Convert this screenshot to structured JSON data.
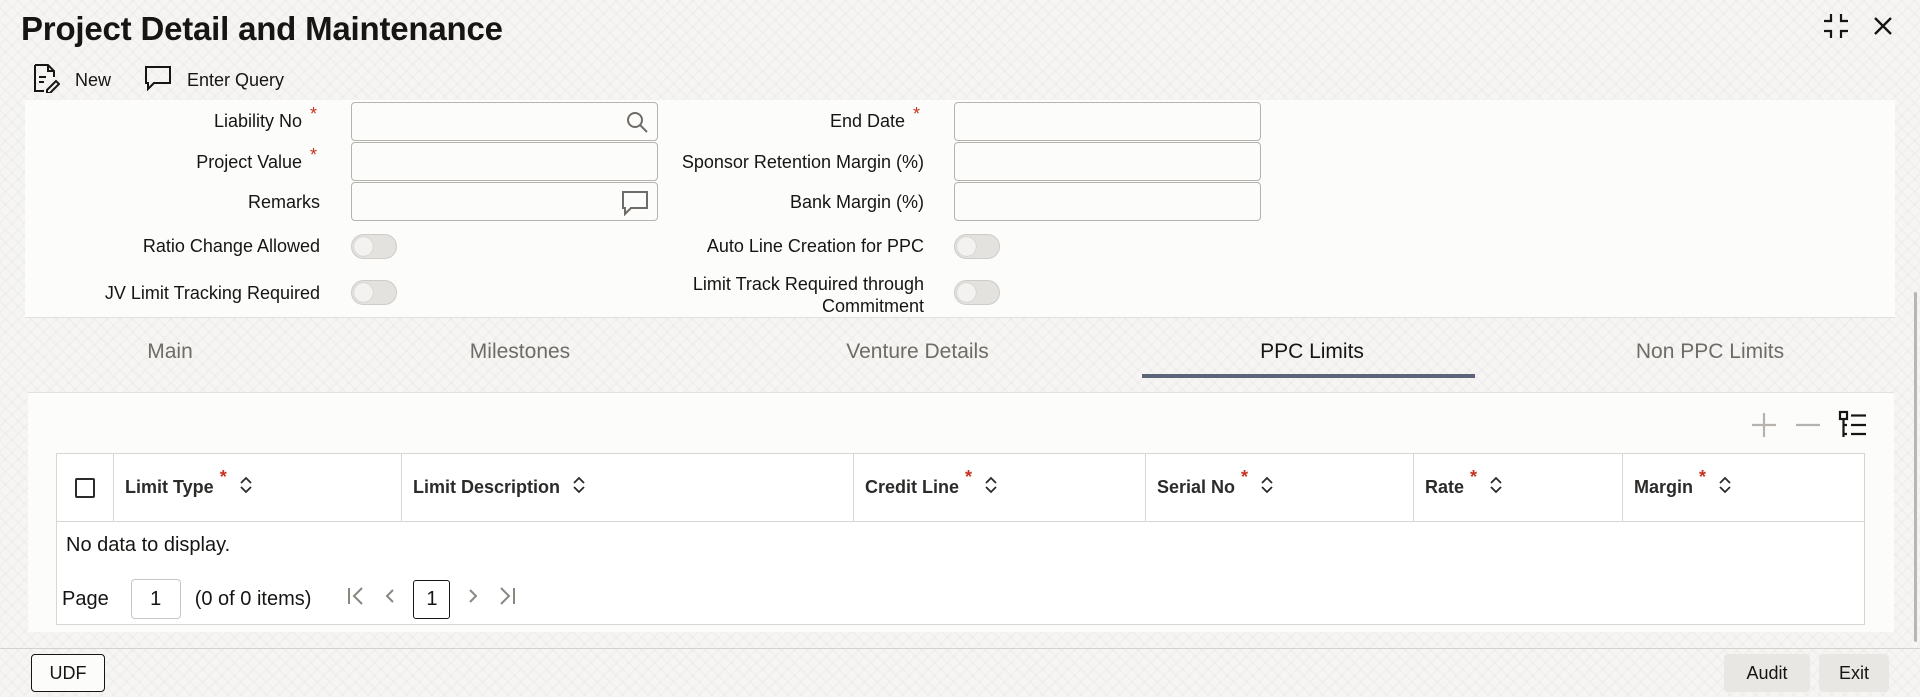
{
  "window": {
    "title": "Project Detail and Maintenance"
  },
  "toolbar": {
    "new_label": "New",
    "enter_query_label": "Enter Query"
  },
  "form": {
    "liability_no_label": "Liability No",
    "project_value_label": "Project Value",
    "remarks_label": "Remarks",
    "ratio_change_label": "Ratio Change Allowed",
    "jv_limit_label": "JV Limit Tracking Required",
    "end_date_label": "End Date",
    "sponsor_margin_label": "Sponsor Retention Margin (%)",
    "bank_margin_label": "Bank Margin (%)",
    "auto_line_label": "Auto Line Creation for PPC",
    "limit_track_label_1": "Limit Track Required through",
    "limit_track_label_2": "Commitment",
    "required_mark": "*",
    "liability_no_value": "",
    "project_value_value": "",
    "remarks_value": "",
    "end_date_value": "",
    "sponsor_margin_value": "",
    "bank_margin_value": ""
  },
  "tabs": {
    "main": "Main",
    "milestones": "Milestones",
    "venture_details": "Venture Details",
    "ppc_limits": "PPC Limits",
    "non_ppc_limits": "Non PPC Limits",
    "active": "PPC Limits"
  },
  "grid": {
    "columns": {
      "limit_type": "Limit Type",
      "limit_description": "Limit Description",
      "credit_line": "Credit Line",
      "serial_no": "Serial No",
      "rate": "Rate",
      "margin": "Margin"
    },
    "empty_message": "No data to display.",
    "rows": []
  },
  "pagination": {
    "page_label": "Page",
    "page_input_value": "1",
    "items_summary": "(0 of 0 items)",
    "current_page": "1"
  },
  "footer": {
    "udf_label": "UDF",
    "audit_label": "Audit",
    "exit_label": "Exit"
  },
  "colors": {
    "required": "#c7321f",
    "active_tab_underline": "#5b6479",
    "text": "#161513",
    "muted_text": "#6f6b66"
  },
  "icons": [
    "new-document-icon",
    "enter-query-icon",
    "search-icon",
    "comment-icon",
    "collapse-icon",
    "close-icon",
    "add-row-icon",
    "delete-row-icon",
    "single-record-view-icon",
    "sort-icon",
    "first-page-icon",
    "previous-page-icon",
    "next-page-icon",
    "last-page-icon"
  ]
}
